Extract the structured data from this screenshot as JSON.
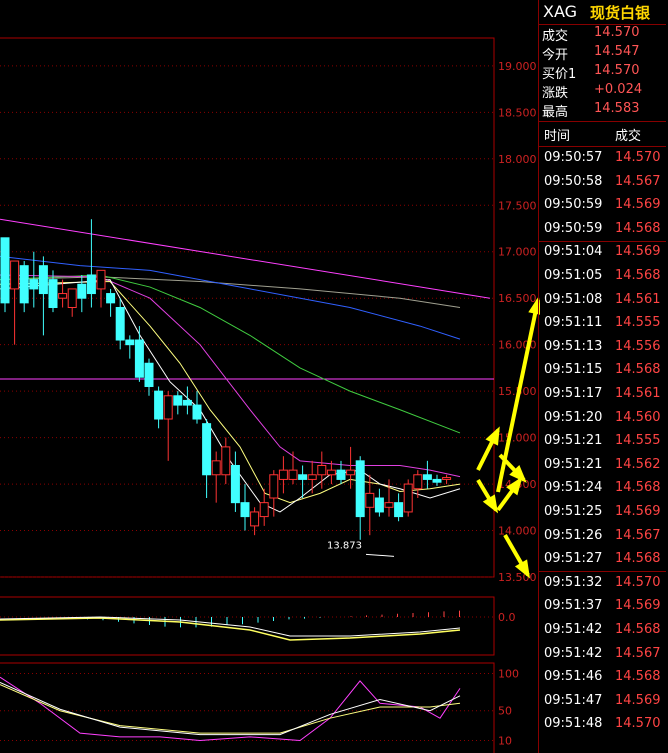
{
  "header": {
    "symbol": "XAG",
    "name": "现货白银"
  },
  "quote": [
    {
      "label": "成交",
      "value": "14.570"
    },
    {
      "label": "今开",
      "value": "14.547"
    },
    {
      "label": "买价1",
      "value": "14.570"
    },
    {
      "label": "涨跌",
      "value": "+0.024"
    },
    {
      "label": "最高",
      "value": "14.583"
    }
  ],
  "ticks_header": {
    "time": "时间",
    "price": "成交"
  },
  "ticks": [
    {
      "time": "09:50:57",
      "price": "14.570"
    },
    {
      "time": "09:50:58",
      "price": "14.567"
    },
    {
      "time": "09:50:59",
      "price": "14.569"
    },
    {
      "time": "09:50:59",
      "price": "14.568"
    },
    {
      "time": "09:51:04",
      "price": "14.569"
    },
    {
      "time": "09:51:05",
      "price": "14.568"
    },
    {
      "time": "09:51:08",
      "price": "14.561"
    },
    {
      "time": "09:51:11",
      "price": "14.555"
    },
    {
      "time": "09:51:13",
      "price": "14.556"
    },
    {
      "time": "09:51:15",
      "price": "14.568"
    },
    {
      "time": "09:51:17",
      "price": "14.561"
    },
    {
      "time": "09:51:20",
      "price": "14.560"
    },
    {
      "time": "09:51:21",
      "price": "14.555"
    },
    {
      "time": "09:51:21",
      "price": "14.562"
    },
    {
      "time": "09:51:24",
      "price": "14.568"
    },
    {
      "time": "09:51:25",
      "price": "14.569"
    },
    {
      "time": "09:51:26",
      "price": "14.567"
    },
    {
      "time": "09:51:27",
      "price": "14.568"
    },
    {
      "time": "09:51:32",
      "price": "14.570"
    },
    {
      "time": "09:51:37",
      "price": "14.569"
    },
    {
      "time": "09:51:42",
      "price": "14.568"
    },
    {
      "time": "09:51:42",
      "price": "14.567"
    },
    {
      "time": "09:51:46",
      "price": "14.568"
    },
    {
      "time": "09:51:47",
      "price": "14.569"
    },
    {
      "time": "09:51:48",
      "price": "14.570"
    }
  ],
  "chart_data": {
    "type": "candlestick",
    "ylim": [
      13.5,
      19.3
    ],
    "yticks": [
      "19.000",
      "18.500",
      "18.000",
      "17.500",
      "17.000",
      "16.500",
      "16.000",
      "15.500",
      "15.000",
      "14.500",
      "14.000",
      "13.500"
    ],
    "reference_line": 15.63,
    "low_annotation": "13.873",
    "candles": [
      {
        "o": 17.15,
        "h": 17.15,
        "c": 16.45,
        "l": 16.35
      },
      {
        "o": 16.6,
        "h": 16.75,
        "c": 16.9,
        "l": 16.0
      },
      {
        "o": 16.85,
        "h": 16.9,
        "c": 16.45,
        "l": 16.35
      },
      {
        "o": 16.7,
        "h": 17.0,
        "c": 16.6,
        "l": 16.4
      },
      {
        "o": 16.85,
        "h": 16.95,
        "c": 16.55,
        "l": 16.1
      },
      {
        "o": 16.7,
        "h": 16.8,
        "c": 16.4,
        "l": 16.35
      },
      {
        "o": 16.5,
        "h": 16.7,
        "c": 16.55,
        "l": 16.4
      },
      {
        "o": 16.4,
        "h": 16.5,
        "c": 16.6,
        "l": 16.3
      },
      {
        "o": 16.65,
        "h": 16.75,
        "c": 16.5,
        "l": 16.35
      },
      {
        "o": 16.75,
        "h": 17.35,
        "c": 16.55,
        "l": 16.4
      },
      {
        "o": 16.6,
        "h": 16.8,
        "c": 16.8,
        "l": 16.4
      },
      {
        "o": 16.55,
        "h": 16.6,
        "c": 16.45,
        "l": 16.3
      },
      {
        "o": 16.4,
        "h": 16.5,
        "c": 16.05,
        "l": 15.95
      },
      {
        "o": 16.05,
        "h": 16.1,
        "c": 16.0,
        "l": 15.85
      },
      {
        "o": 16.05,
        "h": 16.2,
        "c": 15.65,
        "l": 15.6
      },
      {
        "o": 15.8,
        "h": 15.85,
        "c": 15.55,
        "l": 15.45
      },
      {
        "o": 15.5,
        "h": 15.55,
        "c": 15.2,
        "l": 15.1
      },
      {
        "o": 15.2,
        "h": 15.5,
        "c": 15.45,
        "l": 14.75
      },
      {
        "o": 15.45,
        "h": 15.5,
        "c": 15.35,
        "l": 15.25
      },
      {
        "o": 15.4,
        "h": 15.55,
        "c": 15.35,
        "l": 15.25
      },
      {
        "o": 15.35,
        "h": 15.5,
        "c": 15.2,
        "l": 15.15
      },
      {
        "o": 15.15,
        "h": 15.2,
        "c": 14.6,
        "l": 14.35
      },
      {
        "o": 14.6,
        "h": 14.85,
        "c": 14.75,
        "l": 14.3
      },
      {
        "o": 14.6,
        "h": 15.0,
        "c": 14.9,
        "l": 14.5
      },
      {
        "o": 14.7,
        "h": 14.85,
        "c": 14.3,
        "l": 14.2
      },
      {
        "o": 14.3,
        "h": 14.5,
        "c": 14.15,
        "l": 14.0
      },
      {
        "o": 14.05,
        "h": 14.25,
        "c": 14.2,
        "l": 13.95
      },
      {
        "o": 14.15,
        "h": 14.45,
        "c": 14.3,
        "l": 14.05
      },
      {
        "o": 14.35,
        "h": 14.65,
        "c": 14.6,
        "l": 14.15
      },
      {
        "o": 14.55,
        "h": 14.8,
        "c": 14.65,
        "l": 14.4
      },
      {
        "o": 14.55,
        "h": 14.85,
        "c": 14.65,
        "l": 14.5
      },
      {
        "o": 14.6,
        "h": 14.7,
        "c": 14.55,
        "l": 14.35
      },
      {
        "o": 14.55,
        "h": 14.75,
        "c": 14.6,
        "l": 14.4
      },
      {
        "o": 14.6,
        "h": 14.85,
        "c": 14.7,
        "l": 14.45
      },
      {
        "o": 14.6,
        "h": 14.75,
        "c": 14.65,
        "l": 14.5
      },
      {
        "o": 14.65,
        "h": 14.75,
        "c": 14.55,
        "l": 14.5
      },
      {
        "o": 14.6,
        "h": 14.9,
        "c": 14.65,
        "l": 14.45
      },
      {
        "o": 14.75,
        "h": 14.8,
        "c": 14.15,
        "l": 13.9
      },
      {
        "o": 14.25,
        "h": 14.6,
        "c": 14.4,
        "l": 13.95
      },
      {
        "o": 14.35,
        "h": 14.45,
        "c": 14.2,
        "l": 14.15
      },
      {
        "o": 14.25,
        "h": 14.55,
        "c": 14.3,
        "l": 14.15
      },
      {
        "o": 14.3,
        "h": 14.4,
        "c": 14.15,
        "l": 14.1
      },
      {
        "o": 14.2,
        "h": 14.55,
        "c": 14.5,
        "l": 14.15
      },
      {
        "o": 14.45,
        "h": 14.65,
        "c": 14.6,
        "l": 14.35
      },
      {
        "o": 14.6,
        "h": 14.75,
        "c": 14.55,
        "l": 14.45
      },
      {
        "o": 14.55,
        "h": 14.6,
        "c": 14.52,
        "l": 14.48
      },
      {
        "o": 14.55,
        "h": 14.6,
        "c": 14.57,
        "l": 14.5
      }
    ],
    "moving_averages": [
      {
        "color": "#ff40ff",
        "values": [
          [
            0,
            17.35
          ],
          [
            490,
            16.5
          ]
        ]
      },
      {
        "color": "#a0a090",
        "values": [
          [
            0,
            16.7
          ],
          [
            100,
            16.73
          ],
          [
            200,
            16.68
          ],
          [
            300,
            16.6
          ],
          [
            400,
            16.5
          ],
          [
            460,
            16.4
          ]
        ]
      },
      {
        "color": "#3060ff",
        "values": [
          [
            0,
            16.95
          ],
          [
            80,
            16.85
          ],
          [
            150,
            16.8
          ],
          [
            250,
            16.6
          ],
          [
            350,
            16.4
          ],
          [
            420,
            16.2
          ],
          [
            460,
            16.06
          ]
        ]
      },
      {
        "color": "#40cc40",
        "values": [
          [
            0,
            16.7
          ],
          [
            100,
            16.75
          ],
          [
            150,
            16.62
          ],
          [
            200,
            16.4
          ],
          [
            250,
            16.1
          ],
          [
            300,
            15.75
          ],
          [
            350,
            15.5
          ],
          [
            400,
            15.3
          ],
          [
            460,
            15.05
          ]
        ]
      },
      {
        "color": "#e040e0",
        "values": [
          [
            0,
            16.75
          ],
          [
            100,
            16.73
          ],
          [
            150,
            16.5
          ],
          [
            200,
            16.0
          ],
          [
            250,
            15.3
          ],
          [
            280,
            14.9
          ],
          [
            300,
            14.75
          ],
          [
            350,
            14.7
          ],
          [
            400,
            14.7
          ],
          [
            430,
            14.65
          ],
          [
            460,
            14.58
          ]
        ]
      },
      {
        "color": "#ffff80",
        "values": [
          [
            0,
            16.65
          ],
          [
            110,
            16.68
          ],
          [
            150,
            16.2
          ],
          [
            180,
            15.8
          ],
          [
            210,
            15.3
          ],
          [
            240,
            14.9
          ],
          [
            265,
            14.4
          ],
          [
            290,
            14.3
          ],
          [
            320,
            14.4
          ],
          [
            350,
            14.55
          ],
          [
            380,
            14.5
          ],
          [
            400,
            14.42
          ],
          [
            430,
            14.45
          ],
          [
            460,
            14.5
          ]
        ]
      },
      {
        "color": "#ffffff",
        "values": [
          [
            0,
            16.6
          ],
          [
            110,
            16.7
          ],
          [
            140,
            16.1
          ],
          [
            170,
            15.6
          ],
          [
            200,
            15.3
          ],
          [
            230,
            14.75
          ],
          [
            260,
            14.3
          ],
          [
            280,
            14.2
          ],
          [
            300,
            14.35
          ],
          [
            330,
            14.6
          ],
          [
            360,
            14.65
          ],
          [
            380,
            14.5
          ],
          [
            400,
            14.45
          ],
          [
            430,
            14.35
          ],
          [
            460,
            14.45
          ]
        ]
      }
    ],
    "macd": {
      "yticks": [
        "0.0"
      ],
      "bars": [
        0,
        0,
        0,
        0,
        -0.2,
        -0.3,
        -0.4,
        -0.6,
        -0.8,
        -1,
        -1.2,
        -1.3,
        -1.3,
        -1.2,
        -1,
        -0.9,
        -0.7,
        -0.5,
        -0.3,
        -0.2,
        -0.1,
        0,
        0.1,
        0.2,
        0.3,
        0.4,
        0.5,
        0.6,
        0.7,
        0.8
      ]
    },
    "kdj": {
      "yticks": [
        "100",
        "50",
        "10"
      ],
      "series": [
        {
          "color": "#ff40ff",
          "values": [
            [
              0,
              95
            ],
            [
              40,
              60
            ],
            [
              80,
              20
            ],
            [
              120,
              15
            ],
            [
              160,
              15
            ],
            [
              200,
              10
            ],
            [
              250,
              15
            ],
            [
              300,
              10
            ],
            [
              330,
              40
            ],
            [
              360,
              90
            ],
            [
              380,
              60
            ],
            [
              420,
              55
            ],
            [
              440,
              40
            ],
            [
              460,
              80
            ]
          ]
        },
        {
          "color": "#ffff80",
          "values": [
            [
              0,
              85
            ],
            [
              60,
              50
            ],
            [
              120,
              30
            ],
            [
              200,
              20
            ],
            [
              280,
              20
            ],
            [
              330,
              40
            ],
            [
              380,
              55
            ],
            [
              430,
              55
            ],
            [
              460,
              60
            ]
          ]
        },
        {
          "color": "#ffffff",
          "values": [
            [
              0,
              88
            ],
            [
              60,
              52
            ],
            [
              120,
              28
            ],
            [
              200,
              18
            ],
            [
              280,
              18
            ],
            [
              330,
              45
            ],
            [
              380,
              65
            ],
            [
              430,
              50
            ],
            [
              460,
              70
            ]
          ]
        }
      ]
    }
  },
  "annotations": {
    "arrow_color": "#ffff00"
  }
}
